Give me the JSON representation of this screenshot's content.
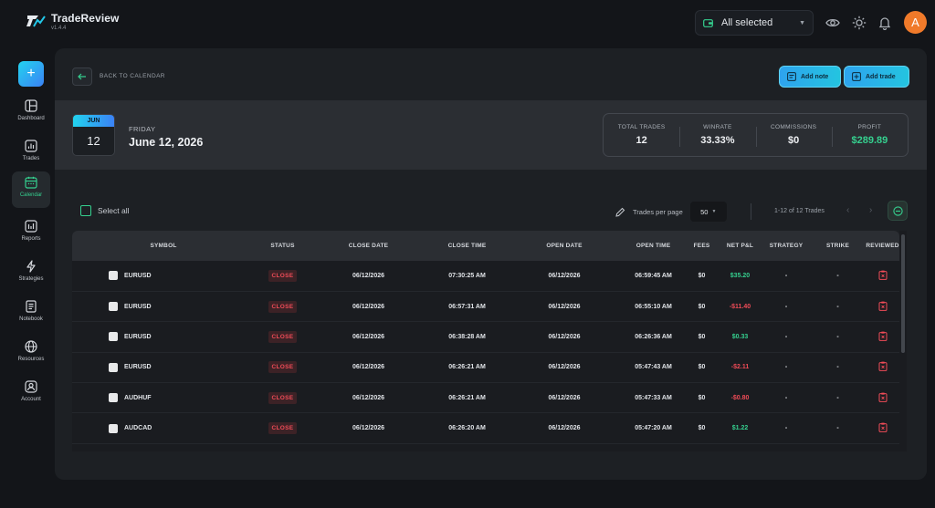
{
  "app": {
    "name": "TradeReview",
    "version": "v1.4.4"
  },
  "topbar": {
    "account_select": "All selected",
    "avatar_letter": "A"
  },
  "sidebar": {
    "items": [
      {
        "label": "Dashboard",
        "icon": "dashboard-icon"
      },
      {
        "label": "Trades",
        "icon": "chart-icon"
      },
      {
        "label": "Calendar",
        "icon": "calendar-icon"
      },
      {
        "label": "Reports",
        "icon": "reports-icon"
      },
      {
        "label": "Strategies",
        "icon": "bolt-icon"
      },
      {
        "label": "Notebook",
        "icon": "notebook-icon"
      },
      {
        "label": "Resources",
        "icon": "globe-icon"
      },
      {
        "label": "Account",
        "icon": "account-icon"
      }
    ],
    "active": "Calendar"
  },
  "header": {
    "back_label": "BACK TO CALENDAR",
    "add_note": "Add note",
    "add_trade": "Add trade"
  },
  "day": {
    "month": "JUN",
    "day_num": "12",
    "weekday": "FRIDAY",
    "full_date": "June 12, 2026"
  },
  "stats": {
    "total_trades_label": "TOTAL TRADES",
    "total_trades": "12",
    "winrate_label": "WINRATE",
    "winrate": "33.33%",
    "commissions_label": "COMMISSIONS",
    "commissions": "$0",
    "profit_label": "PROFIT",
    "profit": "$289.89"
  },
  "toolbar": {
    "select_all": "Select all",
    "per_page_label": "Trades per page",
    "per_page_value": "50",
    "pagination": "1-12 of 12 Trades"
  },
  "table": {
    "columns": [
      "SYMBOL",
      "STATUS",
      "CLOSE DATE",
      "CLOSE TIME",
      "OPEN DATE",
      "OPEN TIME",
      "FEES",
      "NET P&L",
      "STRATEGY",
      "STRIKE",
      "REVIEWED"
    ],
    "rows": [
      {
        "symbol": "EURUSD",
        "status": "CLOSE",
        "close_date": "06/12/2026",
        "close_time": "07:30:25 AM",
        "open_date": "06/12/2026",
        "open_time": "06:59:45 AM",
        "fees": "$0",
        "pnl": "$35.20",
        "pnl_sign": "pos",
        "strategy": "-",
        "strike": "-"
      },
      {
        "symbol": "EURUSD",
        "status": "CLOSE",
        "close_date": "06/12/2026",
        "close_time": "06:57:31 AM",
        "open_date": "06/12/2026",
        "open_time": "06:55:10 AM",
        "fees": "$0",
        "pnl": "-$11.40",
        "pnl_sign": "neg",
        "strategy": "-",
        "strike": "-"
      },
      {
        "symbol": "EURUSD",
        "status": "CLOSE",
        "close_date": "06/12/2026",
        "close_time": "06:38:28 AM",
        "open_date": "06/12/2026",
        "open_time": "06:26:36 AM",
        "fees": "$0",
        "pnl": "$0.33",
        "pnl_sign": "pos",
        "strategy": "-",
        "strike": "-"
      },
      {
        "symbol": "EURUSD",
        "status": "CLOSE",
        "close_date": "06/12/2026",
        "close_time": "06:26:21 AM",
        "open_date": "06/12/2026",
        "open_time": "05:47:43 AM",
        "fees": "$0",
        "pnl": "-$2.11",
        "pnl_sign": "neg",
        "strategy": "-",
        "strike": "-"
      },
      {
        "symbol": "AUDHUF",
        "status": "CLOSE",
        "close_date": "06/12/2026",
        "close_time": "06:26:21 AM",
        "open_date": "06/12/2026",
        "open_time": "05:47:33 AM",
        "fees": "$0",
        "pnl": "-$0.80",
        "pnl_sign": "neg",
        "strategy": "-",
        "strike": "-"
      },
      {
        "symbol": "AUDCAD",
        "status": "CLOSE",
        "close_date": "06/12/2026",
        "close_time": "06:26:20 AM",
        "open_date": "06/12/2026",
        "open_time": "05:47:20 AM",
        "fees": "$0",
        "pnl": "$1.22",
        "pnl_sign": "pos",
        "strategy": "-",
        "strike": "-"
      }
    ]
  },
  "colors": {
    "accent": "#35d08f",
    "negative": "#ef4b57",
    "brand_gradient_start": "#22d3ee",
    "brand_gradient_end": "#3b82f6"
  }
}
